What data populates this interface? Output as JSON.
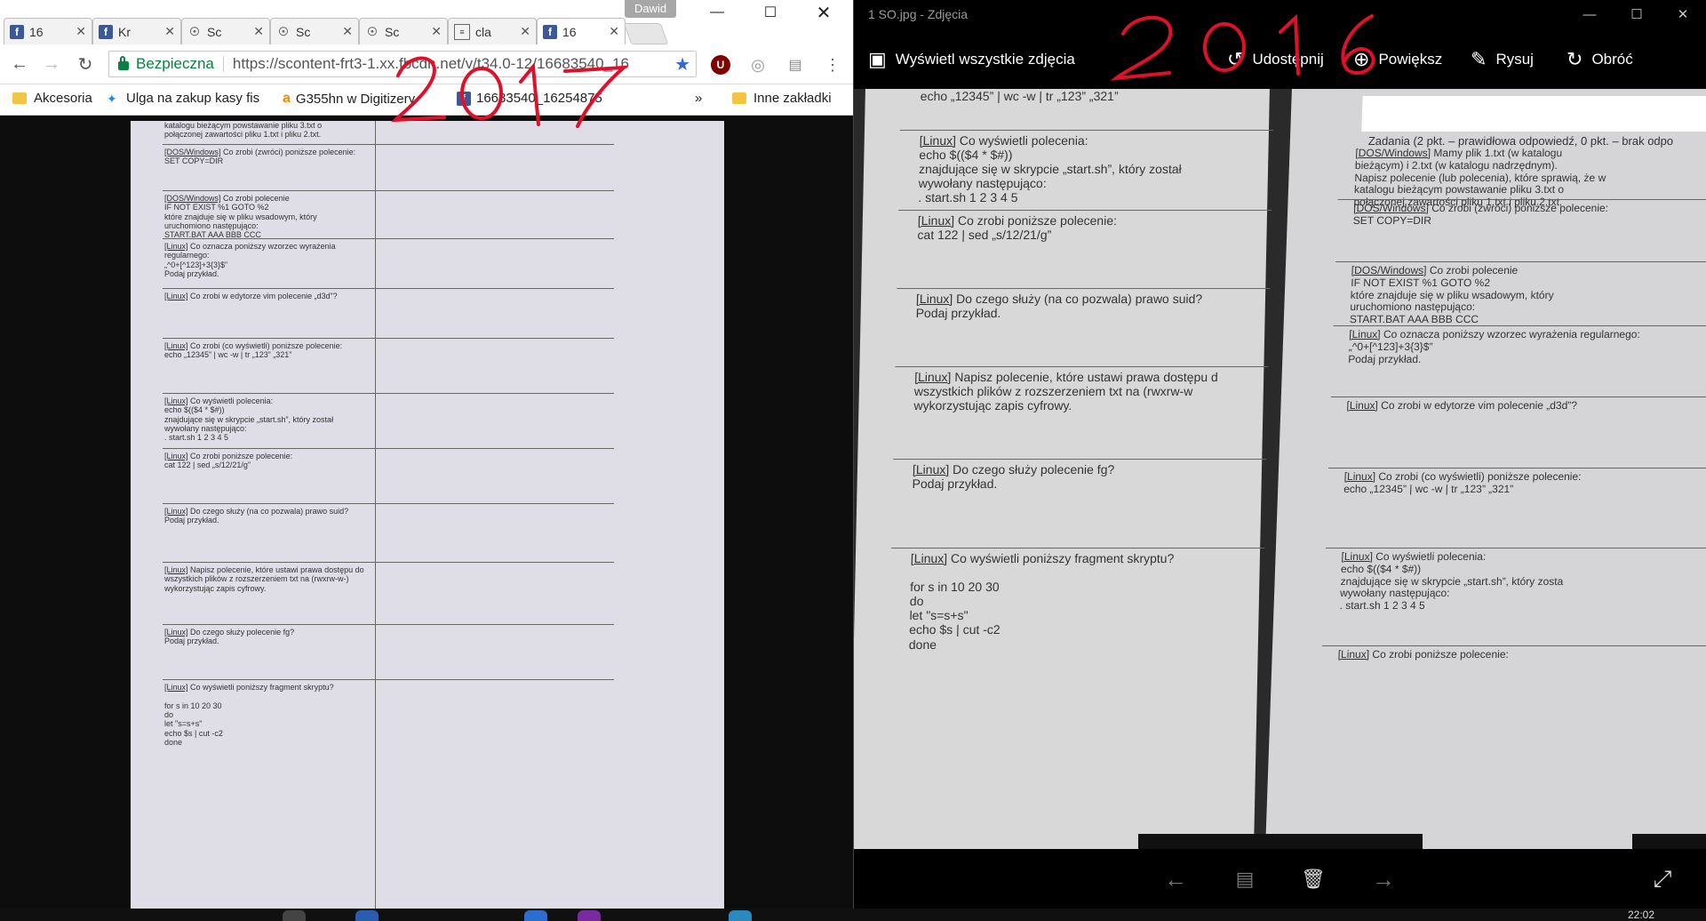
{
  "chrome": {
    "profile_name": "Dawid",
    "tabs": [
      {
        "icon": "facebook",
        "title": "16"
      },
      {
        "icon": "facebook",
        "title": "Kr"
      },
      {
        "icon": "mask",
        "title": "Sc"
      },
      {
        "icon": "mask",
        "title": "Sc"
      },
      {
        "icon": "mask",
        "title": "Sc"
      },
      {
        "icon": "doc",
        "title": "cla"
      },
      {
        "icon": "facebook",
        "title": "16"
      }
    ],
    "address": {
      "secure_label": "Bezpieczna",
      "url": "https://scontent-frt3-1.xx.fbcdn.net/v/t34.0-12/16683540_16"
    },
    "bookmarks": [
      {
        "icon": "folder",
        "label": "Akcesoria"
      },
      {
        "icon": "bulb",
        "label": "Ulga na zakup kasy fis"
      },
      {
        "icon": "amazon",
        "label": "G355hn w Digitizery"
      },
      {
        "icon": "facebook",
        "label": "16683540_16254875"
      },
      {
        "icon": "chevron",
        "label": "»"
      },
      {
        "icon": "folder",
        "label": "Inne zakładki"
      }
    ],
    "document_rows": [
      {
        "tag": "",
        "text": "katalogu bieżącym powstawanie pliku 3.txt o\npołączonej zawartości pliku 1.txt i pliku 2.txt."
      },
      {
        "tag": "[DOS/Windows]",
        "text": "Co zrobi (zwróci) poniższe polecenie:\nSET COPY=DIR"
      },
      {
        "tag": "[DOS/Windows]",
        "text": "Co zrobi polecenie\nIF NOT EXIST %1 GOTO %2\nktóre znajduje się w pliku wsadowym, który\nuruchomiono następująco:\nSTART.BAT AAA BBB CCC"
      },
      {
        "tag": "[Linux]",
        "text": "Co oznacza poniższy wzorzec wyrażenia regularnego:\n„^0+[^123]+3{3}$”\nPodaj przykład."
      },
      {
        "tag": "[Linux]",
        "text": "Co zrobi w edytorze vim polecenie „d3d”?"
      },
      {
        "tag": "[Linux]",
        "text": "Co zrobi (co wyświetli) poniższe polecenie:\necho „12345” | wc -w | tr „123” „321”"
      },
      {
        "tag": "[Linux]",
        "text": "Co wyświetli polecenia:\necho $(($4 * $#))\nznajdujące się w skrypcie „start.sh”, który został\nwywołany następująco:\n. start.sh 1 2 3 4 5"
      },
      {
        "tag": "[Linux]",
        "text": "Co zrobi poniższe polecenie:\ncat 122 | sed „s/12/21/g”"
      },
      {
        "tag": "[Linux]",
        "text": "Do czego służy (na co pozwala) prawo suid?\nPodaj przykład."
      },
      {
        "tag": "[Linux]",
        "text": "Napisz polecenie, które ustawi prawa dostępu do\nwszystkich plików z rozszerzeniem txt na (rwxrw-w-)\nwykorzystując zapis cyfrowy."
      },
      {
        "tag": "[Linux]",
        "text": "Do czego służy polecenie fg?\nPodaj przykład."
      },
      {
        "tag": "[Linux]",
        "text": "Co wyświetli poniższy fragment skryptu?\n\nfor s in 10 20 30\ndo\n            let \"s=s+s\"\n            echo $s | cut -c2\ndone"
      }
    ],
    "annotation": "2017"
  },
  "photos": {
    "window_title": "1 SO.jpg - Zdjęcia",
    "command_bar": {
      "see_all": "Wyświetl wszystkie zdjęcia",
      "share": "Udostępnij",
      "zoom": "Powiększ",
      "draw": "Rysuj",
      "rotate": "Obróć"
    },
    "annotation": "2016",
    "left_page_rows": [
      {
        "tag": "",
        "text": "echo „12345” | wc -w | tr „123” „321”"
      },
      {
        "tag": "[Linux]",
        "text": "Co wyświetli polecenia:\necho $(($4 * $#))\nznajdujące się w skrypcie „start.sh”, który został\nwywołany następująco:\n. start.sh 1 2 3 4 5"
      },
      {
        "tag": "[Linux]",
        "text": "Co zrobi poniższe polecenie:\ncat 122 | sed „s/12/21/g”"
      },
      {
        "tag": "[Linux]",
        "text": "Do czego służy (na co pozwala) prawo suid?\nPodaj przykład."
      },
      {
        "tag": "[Linux]",
        "text": "Napisz polecenie, które ustawi prawa dostępu d\nwszystkich plików z rozszerzeniem txt na (rwxrw-w\nwykorzystując zapis cyfrowy."
      },
      {
        "tag": "[Linux]",
        "text": "Do czego służy polecenie fg?\nPodaj przykład."
      },
      {
        "tag": "[Linux]",
        "text": "Co wyświetli poniższy fragment skryptu?\n\nfor s in 10 20 30\ndo\n          let \"s=s+s\"\n          echo $s | cut -c2\ndone"
      }
    ],
    "right_page_heading": "Zadania (2 pkt. – prawidłowa odpowiedź, 0 pkt. – brak odpo",
    "right_page_rows": [
      {
        "tag": "[DOS/Windows]",
        "text": "Mamy plik 1.txt (w katalogu\nbieżącym) i 2.txt (w katalogu nadrzędnym).\nNapisz polecenie (lub polecenia), które sprawią, że w\nkatalogu bieżącym powstawanie pliku 3.txt o\npołączonej zawartości pliku 1.txt i pliku 2.txt."
      },
      {
        "tag": "[DOS/Windows]",
        "text": "Co zrobi (zwróci) poniższe polecenie:\nSET COPY=DIR"
      },
      {
        "tag": "[DOS/Windows]",
        "text": "Co zrobi polecenie\nIF NOT EXIST %1 GOTO %2\nktóre znajduje się w pliku wsadowym, który\nuruchomiono następująco:\nSTART.BAT AAA BBB CCC"
      },
      {
        "tag": "[Linux]",
        "text": "Co oznacza poniższy wzorzec wyrażenia regularnego:\n„^0+[^123]+3{3}$”\nPodaj przykład."
      },
      {
        "tag": "[Linux]",
        "text": "Co zrobi w edytorze vim polecenie „d3d”?"
      },
      {
        "tag": "[Linux]",
        "text": "Co zrobi (co wyświetli) poniższe polecenie:\necho „12345” | wc -w | tr „123” „321”"
      },
      {
        "tag": "[Linux]",
        "text": "Co wyświetli polecenia:\necho $(($4 * $#))\nznajdujące się w skrypcie „start.sh”, który zosta\nwywołany następująco:\n. start.sh 1 2 3 4 5"
      },
      {
        "tag": "[Linux]",
        "text": "Co zrobi poniższe polecenie:"
      }
    ]
  },
  "taskbar": {
    "clock": "22:02"
  },
  "colors": {
    "annotation_red": "#e0102a",
    "secure_green": "#0b8043",
    "facebook_blue": "#3b5998"
  }
}
